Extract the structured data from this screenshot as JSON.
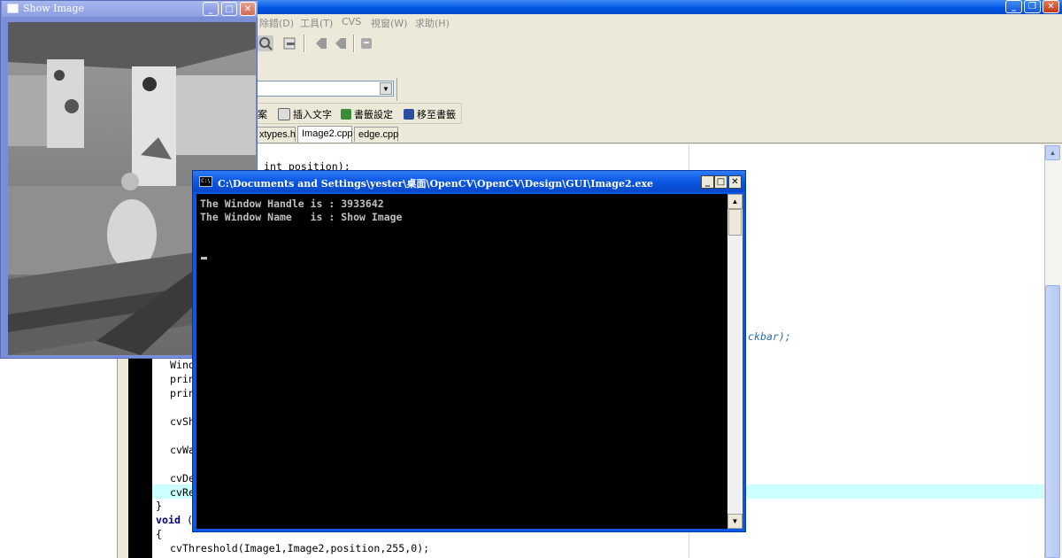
{
  "ide": {
    "menu": [
      "除錯(D)",
      "工具(T)",
      "CVS",
      "視窗(W)",
      "求助(H)"
    ],
    "controls": {
      "minimize": "_",
      "restore": "❐",
      "close": "✕"
    },
    "bookmark_bar": [
      "案",
      "插入文字",
      "書籤設定",
      "移至書籤"
    ],
    "tabs": [
      "xtypes.h",
      "Image2.cpp",
      "edge.cpp"
    ],
    "active_tab": "Image2.cpp",
    "code_top": "int position);",
    "code_left": [
      "Wind",
      "prin",
      "prin",
      "cvSh",
      "cvWa",
      "cvDe",
      "cvRe"
    ],
    "code_comment": "ckbar);",
    "code_bottom": {
      "brace_close": "}",
      "void_kw": "void",
      "void_rest": "(",
      "brace_open": "{",
      "threshold": "cvThreshold(Image1,Image2,position,255,0);"
    }
  },
  "image_window": {
    "title": "Show Image",
    "controls": {
      "minimize": "_",
      "maximize": "□",
      "close": "✕"
    }
  },
  "console": {
    "icon_text": "C:\\",
    "title": "C:\\Documents and Settings\\yester\\桌面\\OpenCV\\OpenCV\\Design\\GUI\\Image2.exe",
    "lines": [
      "The Window Handle is : 3933642",
      "The Window Name   is : Show Image"
    ],
    "controls": {
      "minimize": "_",
      "maximize": "□",
      "close": "✕"
    }
  },
  "colors": {
    "title_active": "#0a56e2",
    "title_inactive": "#8d9fe2",
    "highlight_line": "#ccffff",
    "console_bg": "#000000",
    "console_text": "#c0c0c0"
  }
}
